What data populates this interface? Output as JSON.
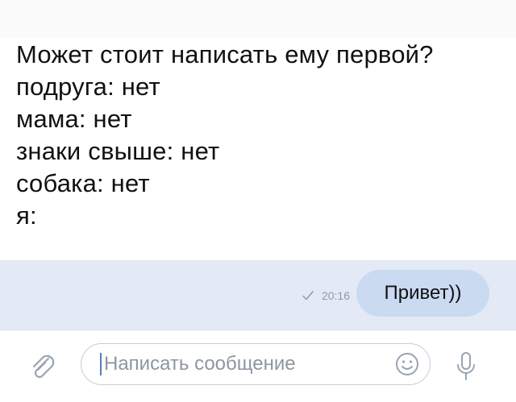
{
  "meme": {
    "lines": [
      "Может стоит написать ему первой?",
      "подруга: нет",
      "мама: нет",
      "знаки свыше: нет",
      "собака: нет",
      "я:"
    ]
  },
  "chat": {
    "message": {
      "text": "Привет))",
      "time": "20:16",
      "status_icon": "check-icon"
    }
  },
  "composer": {
    "placeholder": "Написать сообщение",
    "attach_icon": "paperclip-icon",
    "emoji_icon": "smiley-icon",
    "mic_icon": "microphone-icon"
  },
  "colors": {
    "chat_background": "#e3eaf5",
    "bubble": "#c9daf1",
    "accent": "#5a7dbd",
    "meta_text": "#8a9bb2"
  }
}
